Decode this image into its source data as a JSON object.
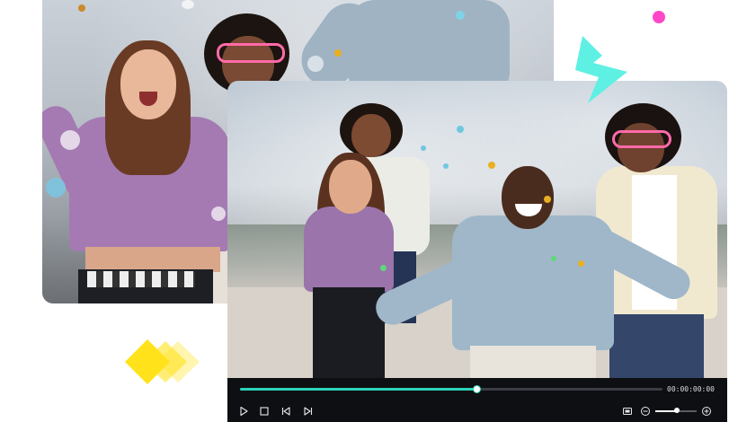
{
  "player": {
    "timecode": "00:00:00:00",
    "progress": 0.56,
    "zoom_level": 0.52,
    "accent_color": "#29d3b8",
    "controls": [
      {
        "name": "play-icon"
      },
      {
        "name": "stop-icon"
      },
      {
        "name": "previous-frame-icon"
      },
      {
        "name": "next-frame-icon"
      }
    ],
    "right_controls": [
      {
        "name": "fullscreen-icon"
      },
      {
        "name": "zoom-out-icon"
      },
      {
        "name": "zoom-in-icon"
      }
    ]
  },
  "decorations": {
    "bolt_color": "#5ff0e4",
    "dot_color": "#ff47c8",
    "diamond_color": "#ffe21a"
  }
}
